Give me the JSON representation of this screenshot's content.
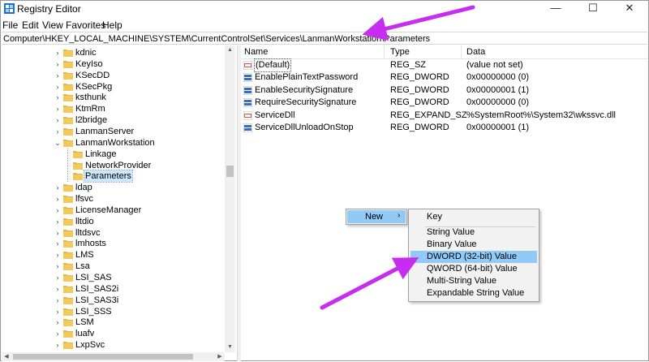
{
  "window": {
    "title": "Registry Editor",
    "controls": {
      "minimize": "—",
      "maximize": "☐",
      "close": "✕"
    }
  },
  "menu": [
    "File",
    "Edit",
    "View",
    "Favorites",
    "Help"
  ],
  "address": "Computer\\HKEY_LOCAL_MACHINE\\SYSTEM\\CurrentControlSet\\Services\\LanmanWorkstation\\Parameters",
  "tree": [
    {
      "label": "kdnic",
      "expander": "›"
    },
    {
      "label": "KeyIso",
      "expander": "›"
    },
    {
      "label": "KSecDD",
      "expander": "›"
    },
    {
      "label": "KSecPkg",
      "expander": "›"
    },
    {
      "label": "ksthunk",
      "expander": "›"
    },
    {
      "label": "KtmRm",
      "expander": "›"
    },
    {
      "label": "l2bridge",
      "expander": "›"
    },
    {
      "label": "LanmanServer",
      "expander": "›"
    },
    {
      "label": "LanmanWorkstation",
      "expander": "⌄"
    },
    {
      "label": "Linkage",
      "expander": ""
    },
    {
      "label": "NetworkProvider",
      "expander": ""
    },
    {
      "label": "Parameters",
      "expander": ""
    },
    {
      "label": "ldap",
      "expander": "›"
    },
    {
      "label": "lfsvc",
      "expander": "›"
    },
    {
      "label": "LicenseManager",
      "expander": "›"
    },
    {
      "label": "lltdio",
      "expander": "›"
    },
    {
      "label": "lltdsvc",
      "expander": "›"
    },
    {
      "label": "lmhosts",
      "expander": "›"
    },
    {
      "label": "LMS",
      "expander": "›"
    },
    {
      "label": "Lsa",
      "expander": "›"
    },
    {
      "label": "LSI_SAS",
      "expander": "›"
    },
    {
      "label": "LSI_SAS2i",
      "expander": "›"
    },
    {
      "label": "LSI_SAS3i",
      "expander": "›"
    },
    {
      "label": "LSI_SSS",
      "expander": "›"
    },
    {
      "label": "LSM",
      "expander": "›"
    },
    {
      "label": "luafv",
      "expander": "›"
    },
    {
      "label": "LxpSvc",
      "expander": "›"
    }
  ],
  "columns": {
    "name": "Name",
    "type": "Type",
    "data": "Data"
  },
  "values": [
    {
      "name": "(Default)",
      "type": "REG_SZ",
      "data": "(value not set)",
      "icon": "string-value-icon"
    },
    {
      "name": "EnablePlainTextPassword",
      "type": "REG_DWORD",
      "data": "0x00000000 (0)",
      "icon": "binary-value-icon"
    },
    {
      "name": "EnableSecuritySignature",
      "type": "REG_DWORD",
      "data": "0x00000001 (1)",
      "icon": "binary-value-icon"
    },
    {
      "name": "RequireSecuritySignature",
      "type": "REG_DWORD",
      "data": "0x00000000 (0)",
      "icon": "binary-value-icon"
    },
    {
      "name": "ServiceDll",
      "type": "REG_EXPAND_SZ",
      "data": "%SystemRoot%\\System32\\wkssvc.dll",
      "icon": "string-value-icon"
    },
    {
      "name": "ServiceDllUnloadOnStop",
      "type": "REG_DWORD",
      "data": "0x00000001 (1)",
      "icon": "binary-value-icon"
    }
  ],
  "context_menu": {
    "new_label": "New",
    "new_chevron": "›",
    "submenu": [
      "Key",
      "String Value",
      "Binary Value",
      "DWORD (32-bit) Value",
      "QWORD (64-bit) Value",
      "Multi-String Value",
      "Expandable String Value"
    ],
    "highlighted": "DWORD (32-bit) Value"
  },
  "colors": {
    "selection": "#cce8ff",
    "menu_highlight": "#91c9f7",
    "annotation_arrow": "#c62df0",
    "folder": "#e8b545"
  }
}
